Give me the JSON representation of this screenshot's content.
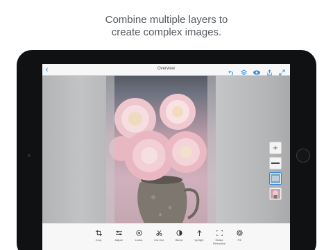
{
  "headline": {
    "line1": "Combine multiple layers to",
    "line2": "create complex images."
  },
  "topbar": {
    "title": "Overview",
    "back_glyph": "‹",
    "icons": [
      "undo-icon",
      "layers-icon",
      "eye-icon",
      "share-icon",
      "expand-icon"
    ]
  },
  "layers": {
    "add_glyph": "+"
  },
  "toolbar": {
    "tools": [
      {
        "label": "Crop",
        "icon": "crop-icon"
      },
      {
        "label": "Adjust",
        "icon": "sliders-icon"
      },
      {
        "label": "Looks",
        "icon": "looks-icon"
      },
      {
        "label": "Cut Out",
        "icon": "scissors-icon"
      },
      {
        "label": "Blend",
        "icon": "blend-icon"
      },
      {
        "label": "Upright",
        "icon": "upright-icon"
      },
      {
        "label": "Shake",
        "label2": "Reduction",
        "icon": "shake-icon"
      },
      {
        "label": "Fill",
        "icon": "fill-icon"
      }
    ]
  },
  "colors": {
    "accent": "#2d8ae0",
    "device": "#101112",
    "headline": "#555a60"
  }
}
